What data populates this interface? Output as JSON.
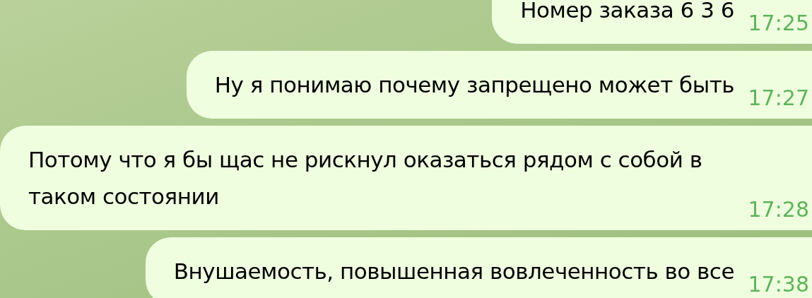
{
  "messages": [
    {
      "text": "Номер заказа 6 3 6",
      "time": "17:25"
    },
    {
      "text": "Ну я понимаю почему запрещено может быть",
      "time": "17:27"
    },
    {
      "text": "Потому что я бы щас не рискнул оказаться рядом с собой в таком состоянии",
      "time": "17:28"
    },
    {
      "text": "Внушаемость, повышенная вовлеченность во все",
      "time": "17:38"
    }
  ]
}
